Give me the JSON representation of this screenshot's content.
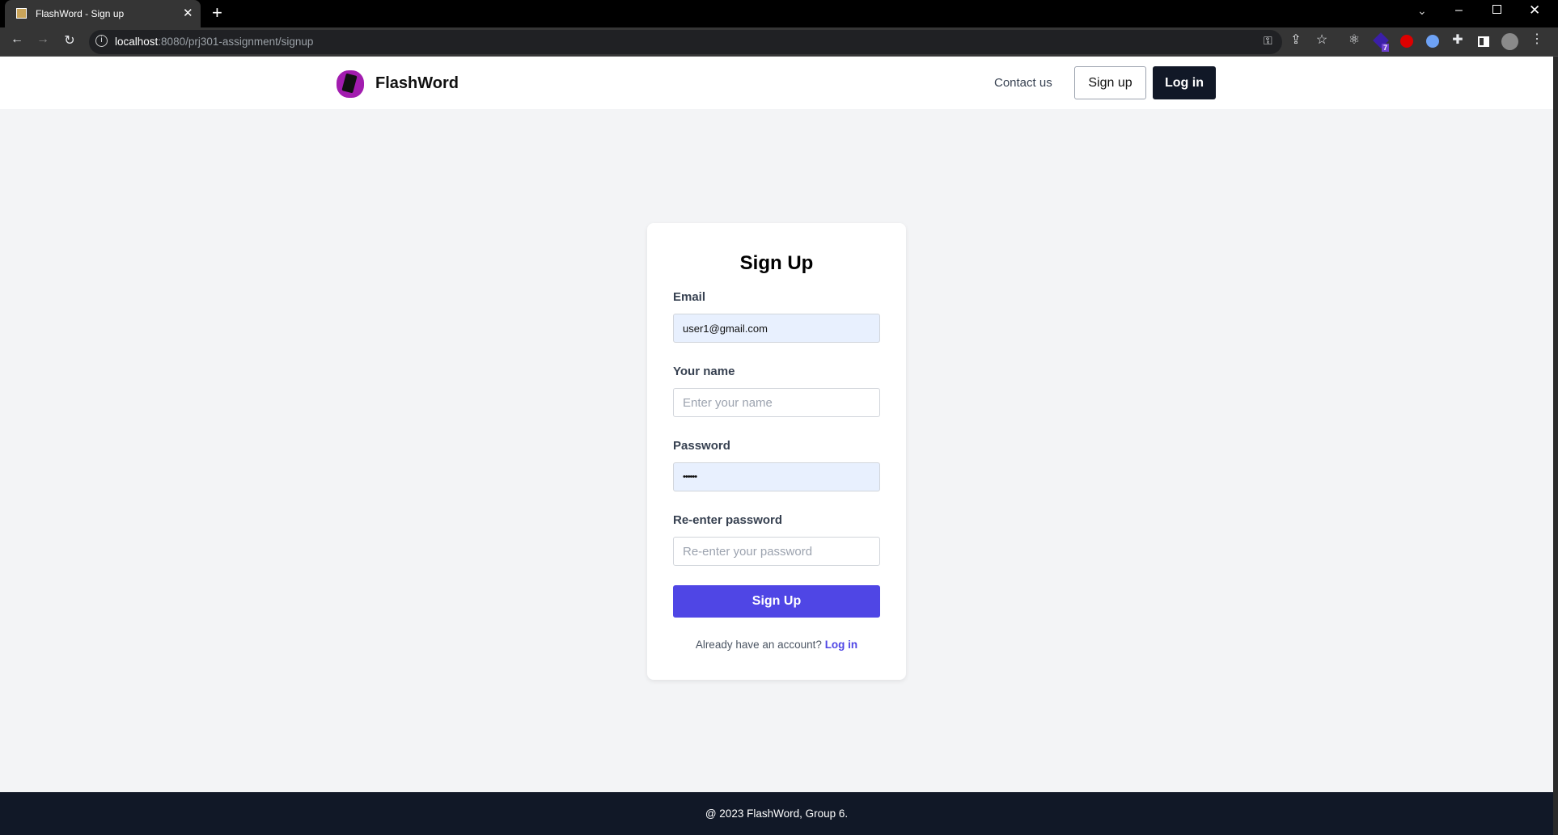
{
  "browser": {
    "tab_title": "FlashWord - Sign up",
    "url_host": "localhost",
    "url_path": ":8080/prj301-assignment/signup",
    "extension_badge": "7"
  },
  "nav": {
    "brand": "FlashWord",
    "contact": "Contact us",
    "signup": "Sign up",
    "login": "Log in"
  },
  "form": {
    "title": "Sign Up",
    "email_label": "Email",
    "email_value": "user1@gmail.com",
    "name_label": "Your name",
    "name_placeholder": "Enter your name",
    "password_label": "Password",
    "password_value": "••••••",
    "repassword_label": "Re-enter password",
    "repassword_placeholder": "Re-enter your password",
    "submit": "Sign Up",
    "already": "Already have an account?",
    "login_link": "Log in"
  },
  "footer": {
    "text": "@ 2023 FlashWord, Group 6."
  },
  "colors": {
    "primary": "#4f46e5",
    "dark": "#111827",
    "bg": "#f3f4f6"
  }
}
